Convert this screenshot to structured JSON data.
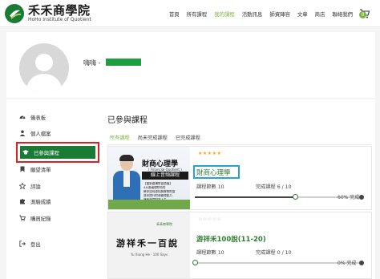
{
  "logo": {
    "title": "禾禾商學院",
    "subtitle": "HoHo Institute of Quotient"
  },
  "nav": {
    "items": [
      "首頁",
      "所有課程",
      "我的課程",
      "活動訊息",
      "師資陣容",
      "文章",
      "商店",
      "聯絡我們"
    ],
    "active_index": 2,
    "cart_count": "0"
  },
  "profile": {
    "username": "嗨嗨 -"
  },
  "sidebar": {
    "items": [
      {
        "label": "儀表板",
        "icon": "dashboard-icon"
      },
      {
        "label": "個人檔案",
        "icon": "user-icon"
      },
      {
        "label": "已參與課程",
        "icon": "graduation-cap-icon"
      },
      {
        "label": "願望清單",
        "icon": "bookmark-icon"
      },
      {
        "label": "評論",
        "icon": "star-icon"
      },
      {
        "label": "測驗成績",
        "icon": "puzzle-icon"
      },
      {
        "label": "購買紀錄",
        "icon": "cart-icon"
      },
      {
        "label": "登出",
        "icon": "logout-icon"
      }
    ],
    "active_index": 2
  },
  "content": {
    "title": "已參與課程",
    "tabs": [
      "所有課程",
      "尚未完成課程",
      "已完成課程"
    ],
    "active_tab": 0
  },
  "courses": [
    {
      "name": "財商心理學",
      "lessons_label": "課程節數 10",
      "done_label": "完成課程 6 / 10",
      "progress": 0.6,
      "progress_text": "60% 完成",
      "stars": 5,
      "thumb": {
        "title": "財商心理學",
        "sub": "( Financial Quotient )",
        "band": "線上音頻課程",
        "lines": [
          "【重新建構財富價值】",
          "4大風格理財特質",
          "教你如何認知與實際財富",
          "幫你提升財商管理能力",
          "擁有滿意財富人生"
        ]
      }
    },
    {
      "name": "游祥禾100說(11-20)",
      "lessons_label": "課程節數 10",
      "done_label": "完成課程 0 / 10",
      "progress": 0,
      "progress_text": "0% 完成",
      "stars": 0,
      "thumb": {
        "logo": "禾禾商學院",
        "title": "游祥禾一百說",
        "sub": "Yu Xiang He · 100 Says"
      }
    }
  ],
  "colors": {
    "brand_green": "#1b7a34",
    "accent_green": "#7cb342",
    "highlight_red": "#e02020",
    "highlight_blue": "#29a3d6"
  }
}
